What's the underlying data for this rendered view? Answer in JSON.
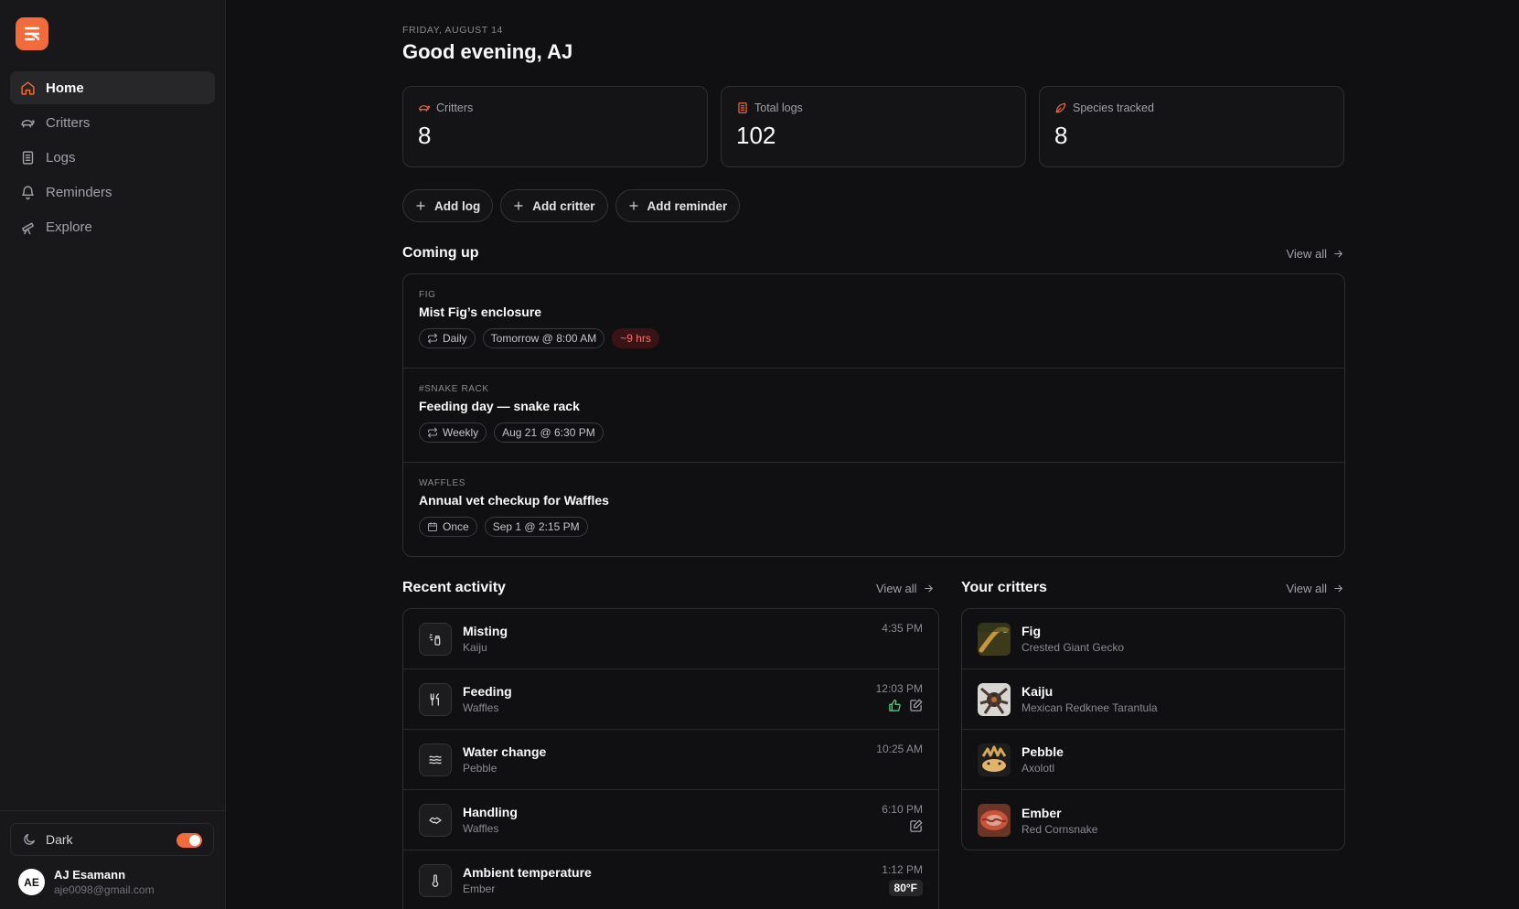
{
  "sidebar": {
    "nav": [
      {
        "label": "Home",
        "icon": "home-icon",
        "active": true
      },
      {
        "label": "Critters",
        "icon": "turtle-icon"
      },
      {
        "label": "Logs",
        "icon": "logs-icon"
      },
      {
        "label": "Reminders",
        "icon": "bell-icon"
      },
      {
        "label": "Explore",
        "icon": "telescope-icon"
      }
    ],
    "theme_label": "Dark",
    "user": {
      "initials": "AE",
      "name": "AJ Esamann",
      "email": "aje0098@gmail.com"
    }
  },
  "header": {
    "date": "FRIDAY, AUGUST 14",
    "greeting": "Good evening, AJ"
  },
  "stats": [
    {
      "label": "Critters",
      "value": "8",
      "icon": "turtle-icon"
    },
    {
      "label": "Total logs",
      "value": "102",
      "icon": "logs-icon"
    },
    {
      "label": "Species tracked",
      "value": "8",
      "icon": "leaf-icon"
    }
  ],
  "actions": [
    "Add log",
    "Add critter",
    "Add reminder"
  ],
  "coming_up": {
    "title": "Coming up",
    "view_all": "View all",
    "items": [
      {
        "tag": "FIG",
        "title": "Mist Fig’s enclosure",
        "recurrence": "Daily",
        "when": "Tomorrow @ 8:00 AM",
        "due": "~9 hrs"
      },
      {
        "tag": "#SNAKE RACK",
        "title": "Feeding day — snake rack",
        "recurrence": "Weekly",
        "when": "Aug 21 @ 6:30 PM"
      },
      {
        "tag": "WAFFLES",
        "title": "Annual vet checkup for Waffles",
        "recurrence": "Once",
        "when": "Sep 1 @ 2:15 PM"
      }
    ]
  },
  "recent_activity": {
    "title": "Recent activity",
    "view_all": "View all",
    "items": [
      {
        "title": "Misting",
        "critter": "Kaiju",
        "time": "4:35 PM",
        "icon": "spray-bottle-icon"
      },
      {
        "title": "Feeding",
        "critter": "Waffles",
        "time": "12:03 PM",
        "icon": "utensils-icon"
      },
      {
        "title": "Water change",
        "critter": "Pebble",
        "time": "10:25 AM",
        "icon": "waves-icon"
      },
      {
        "title": "Handling",
        "critter": "Waffles",
        "time": "6:10 PM",
        "icon": "handshake-icon"
      },
      {
        "title": "Ambient temperature",
        "critter": "Ember",
        "time": "1:12 PM",
        "icon": "thermometer-icon",
        "value": "80°F"
      }
    ]
  },
  "your_critters": {
    "title": "Your critters",
    "view_all": "View all",
    "items": [
      {
        "name": "Fig",
        "species": "Crested Giant Gecko"
      },
      {
        "name": "Kaiju",
        "species": "Mexican Redknee Tarantula"
      },
      {
        "name": "Pebble",
        "species": "Axolotl"
      },
      {
        "name": "Ember",
        "species": "Red Cornsnake"
      }
    ]
  },
  "colors": {
    "accent": "#f26b3a",
    "warn": "#f87171",
    "positive": "#4ade80"
  }
}
